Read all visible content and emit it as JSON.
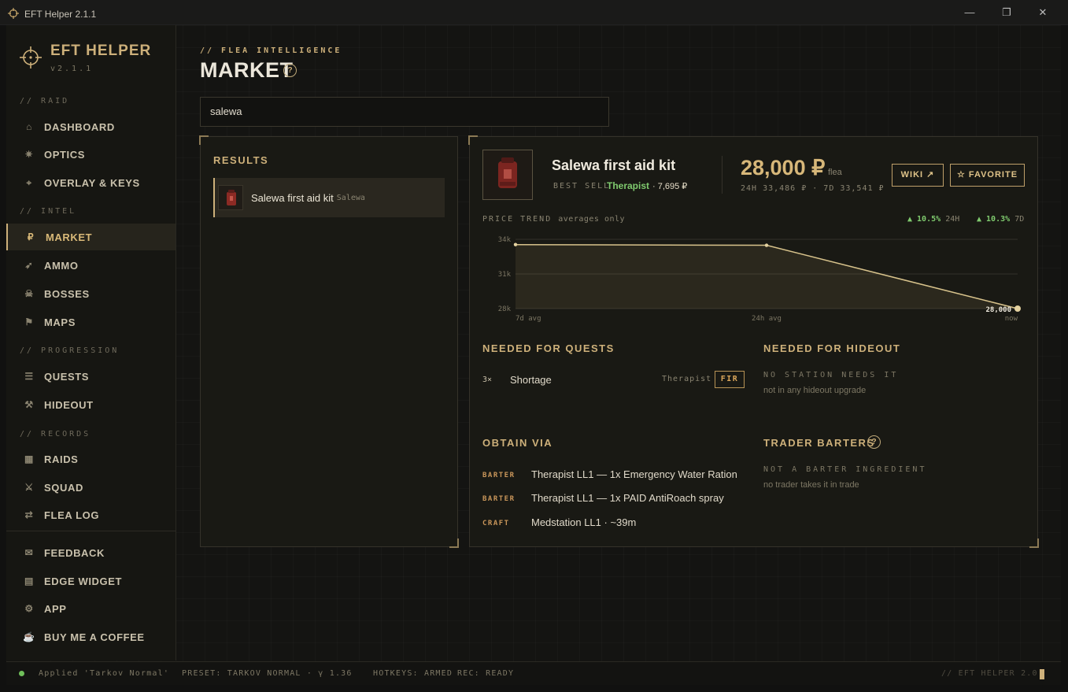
{
  "window": {
    "title": "EFT Helper 2.1.1",
    "minimize": "—",
    "restore": "❐",
    "close": "✕"
  },
  "sidebar": {
    "brand": "EFT HELPER",
    "version": "v2.1.1",
    "sections": {
      "raid": "// RAID",
      "intel": "// INTEL",
      "progression": "// PROGRESSION",
      "records": "// RECORDS"
    },
    "items": [
      {
        "label": "DASHBOARD",
        "icon": "⌂"
      },
      {
        "label": "OPTICS",
        "icon": "✷"
      },
      {
        "label": "OVERLAY & KEYS",
        "icon": "⌖"
      },
      {
        "label": "MARKET",
        "icon": "₽"
      },
      {
        "label": "AMMO",
        "icon": "➶"
      },
      {
        "label": "BOSSES",
        "icon": "☠"
      },
      {
        "label": "MAPS",
        "icon": "⚑"
      },
      {
        "label": "QUESTS",
        "icon": "☰"
      },
      {
        "label": "HIDEOUT",
        "icon": "⚒"
      },
      {
        "label": "RAIDS",
        "icon": "▦"
      },
      {
        "label": "SQUAD",
        "icon": "⚔"
      },
      {
        "label": "FLEA LOG",
        "icon": "⇄"
      },
      {
        "label": "FEEDBACK",
        "icon": "✉"
      },
      {
        "label": "EDGE WIDGET",
        "icon": "▤"
      },
      {
        "label": "APP",
        "icon": "⚙"
      },
      {
        "label": "BUY ME A COFFEE",
        "icon": "☕"
      }
    ],
    "active": "MARKET"
  },
  "header": {
    "kicker": "// FLEA INTELLIGENCE",
    "title": "MARKET",
    "help": "?"
  },
  "search": {
    "value": "salewa"
  },
  "results": {
    "title": "RESULTS",
    "items": [
      {
        "name": "Salewa first aid kit",
        "short": "Salewa"
      }
    ]
  },
  "detail": {
    "name": "Salewa first aid kit",
    "best_sell_label": "BEST SELL",
    "best_sell_trader": "Therapist",
    "best_sell_price": "· 7,695 ₽",
    "price": "28,000 ₽",
    "price_unit": "flea",
    "avgs": "24H 33,486 ₽ · 7D 33,541 ₽",
    "wiki_btn": "WIKI ↗",
    "favorite_btn": "☆ FAVORITE",
    "trend_label": "PRICE TREND",
    "trend_sub": "averages only",
    "change_24h": "▲ 10.5%",
    "change_24h_label": "24H",
    "change_7d": "▲ 10.3%",
    "change_7d_label": "7D"
  },
  "chart_data": {
    "type": "area",
    "x": [
      "7d avg",
      "24h avg",
      "now"
    ],
    "values": [
      33541,
      33486,
      28000
    ],
    "yticks": [
      "34k",
      "31k",
      "28k"
    ],
    "ylim": [
      28000,
      34000
    ],
    "end_label": "28,000",
    "end_sub": "now",
    "grid": true,
    "line_color": "#d8c38c"
  },
  "quests": {
    "title": "NEEDED FOR QUESTS",
    "items": [
      {
        "qty": "3×",
        "name": "Shortage",
        "trader": "Therapist",
        "tag": "FIR"
      }
    ]
  },
  "hideout": {
    "title": "NEEDED FOR HIDEOUT",
    "status": "NO STATION NEEDS IT",
    "note": "not in any hideout upgrade"
  },
  "obtain": {
    "title": "OBTAIN VIA",
    "items": [
      {
        "type": "BARTER",
        "text": "Therapist LL1 — 1x Emergency Water Ration"
      },
      {
        "type": "BARTER",
        "text": "Therapist LL1 — 1x PAID AntiRoach spray"
      },
      {
        "type": "CRAFT",
        "text": "Medstation LL1 · ~39m"
      }
    ]
  },
  "barters": {
    "title": "TRADER BARTERS",
    "help": "?",
    "status": "NOT A BARTER INGREDIENT",
    "note": "no trader takes it in trade"
  },
  "status": {
    "applied": "Applied 'Tarkov Normal'",
    "preset": "PRESET: TARKOV NORMAL · γ 1.36",
    "hotkeys": "HOTKEYS: ARMED",
    "rec": "REC: READY",
    "brand": "// EFT HELPER 2.0"
  },
  "colors": {
    "accent": "#cdb07a",
    "positive": "#7fca6e",
    "background": "#141412"
  }
}
